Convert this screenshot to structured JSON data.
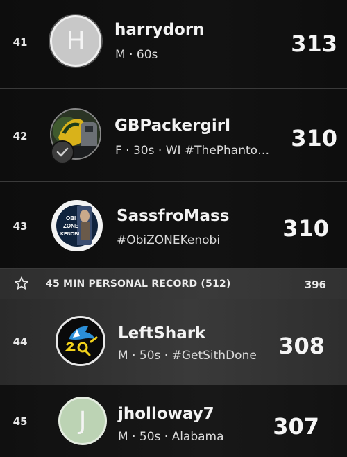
{
  "leaderboard": {
    "rows": [
      {
        "rank": "41",
        "username": "harrydorn",
        "meta": "M · 60s",
        "score": "313",
        "avatar_type": "letter",
        "avatar_letter": "H",
        "avatar_color": "#c8c8c8"
      },
      {
        "rank": "42",
        "username": "GBPackergirl",
        "meta": "F · 30s · WI #ThePhanto…",
        "score": "310",
        "avatar_type": "photo",
        "verified": true
      },
      {
        "rank": "43",
        "username": "SassfroMass",
        "meta": "#ObiZONEKenobi",
        "score": "310",
        "avatar_type": "logo",
        "avatar_logo_lines": [
          "OBI",
          "ZONE",
          "KENOBI"
        ]
      },
      {
        "rank": "44",
        "username": "LeftShark",
        "meta": "M · 50s · #GetSithDone",
        "score": "308",
        "avatar_type": "shark",
        "highlighted": true
      },
      {
        "rank": "45",
        "username": "jholloway7",
        "meta": "M · 50s · Alabama",
        "score": "307",
        "avatar_type": "letter",
        "avatar_letter": "J",
        "avatar_color": "#bcd3b4"
      }
    ],
    "personal_record": {
      "icon": "star-icon",
      "label": "45 MIN PERSONAL RECORD (512)",
      "value": "396"
    }
  },
  "colors": {
    "background": "#0b0b0b",
    "highlight_row": "#3a3a3a",
    "shark_yellow": "#f2d21b",
    "shark_blue": "#2b8fd8"
  }
}
